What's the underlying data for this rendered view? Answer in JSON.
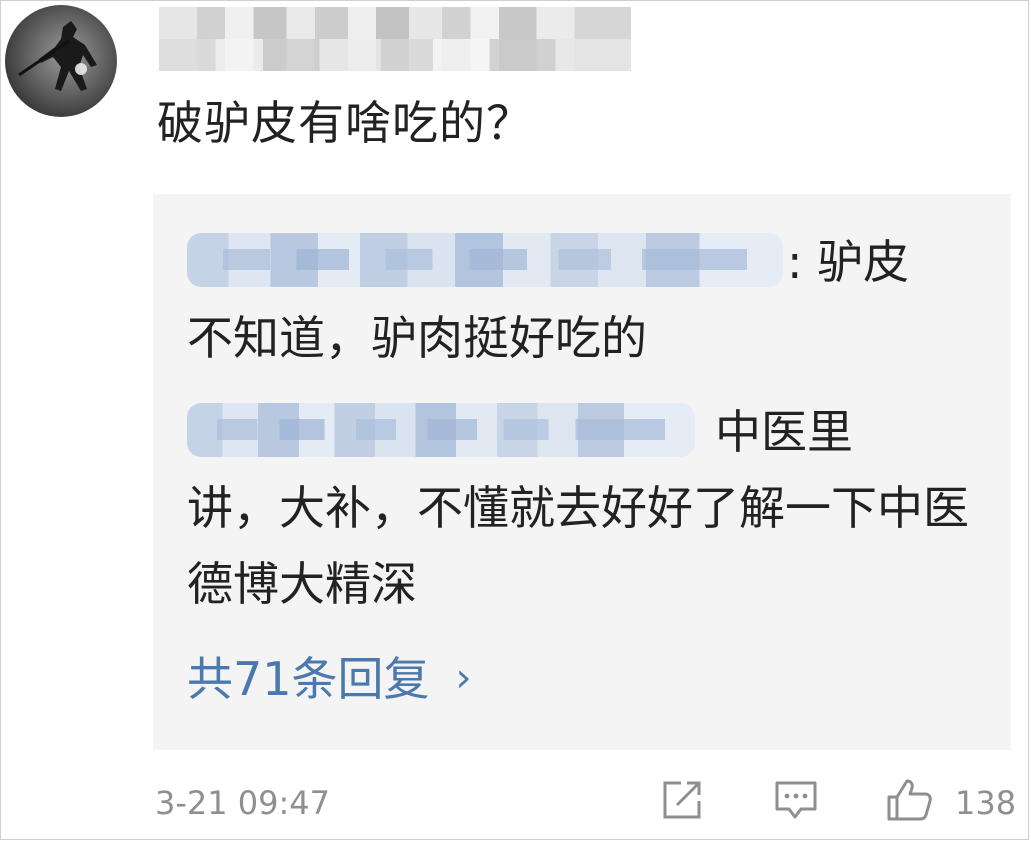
{
  "comment": {
    "text": "破驴皮有啥吃的？",
    "timestamp": "3-21 09:47",
    "like_count": "138"
  },
  "replies": [
    {
      "text_line1": ": 驴皮",
      "text_rest": "不知道，驴肉挺好吃的"
    },
    {
      "text_line1": "中医里",
      "text_rest": "讲，大补，不懂就去好好了解一下中医德博大精深"
    }
  ],
  "more_replies_label": "共71条回复",
  "more_replies_chevron": "›",
  "icons": {
    "share": "share-icon",
    "comment": "comment-icon",
    "like": "thumbs-up-icon"
  },
  "colors": {
    "link": "#4a79ad",
    "meta": "#8f8f8f",
    "reply_bg": "#f4f4f4",
    "text": "#222222"
  }
}
